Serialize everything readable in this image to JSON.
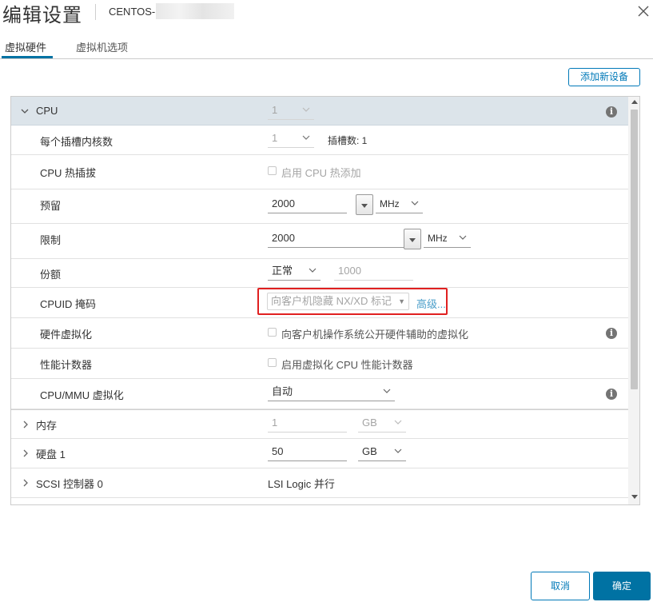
{
  "dialog": {
    "title": "编辑设置",
    "vm_name": "CENTOS-",
    "close_icon": "close-icon"
  },
  "tabs": [
    {
      "label": "虚拟硬件",
      "active": true
    },
    {
      "label": "虚拟机选项",
      "active": false
    }
  ],
  "toolbar": {
    "add_device_label": "添加新设备"
  },
  "cpu": {
    "label": "CPU",
    "value": "1",
    "cores_per_socket": {
      "label": "每个插槽内核数",
      "value": "1",
      "sockets_label": "插槽数: 1"
    },
    "hot_plug": {
      "label": "CPU 热插拔",
      "checkbox_label": "启用 CPU 热添加"
    },
    "reservation": {
      "label": "预留",
      "value": "2000",
      "unit": "MHz"
    },
    "limit": {
      "label": "限制",
      "value": "2000",
      "unit": "MHz"
    },
    "shares": {
      "label": "份额",
      "level": "正常",
      "value": "1000"
    },
    "cpuid_mask": {
      "label": "CPUID 掩码",
      "value": "向客户机隐藏 NX/XD 标记",
      "advanced_link": "高级..."
    },
    "hw_virtualization": {
      "label": "硬件虚拟化",
      "checkbox_label": "向客户机操作系统公开硬件辅助的虚拟化"
    },
    "perf_counters": {
      "label": "性能计数器",
      "checkbox_label": "启用虚拟化 CPU 性能计数器"
    },
    "mmu_virtualization": {
      "label": "CPU/MMU 虚拟化",
      "value": "自动"
    }
  },
  "memory": {
    "label": "内存",
    "value": "1",
    "unit": "GB"
  },
  "disk": {
    "label": "硬盘 1",
    "value": "50",
    "unit": "GB"
  },
  "scsi": {
    "label": "SCSI 控制器 0",
    "value": "LSI Logic 并行"
  },
  "footer": {
    "cancel_label": "取消",
    "ok_label": "确定"
  },
  "colors": {
    "accent": "#0072a3",
    "highlight": "#e02020",
    "cpu_header_bg": "#dce4ea"
  }
}
